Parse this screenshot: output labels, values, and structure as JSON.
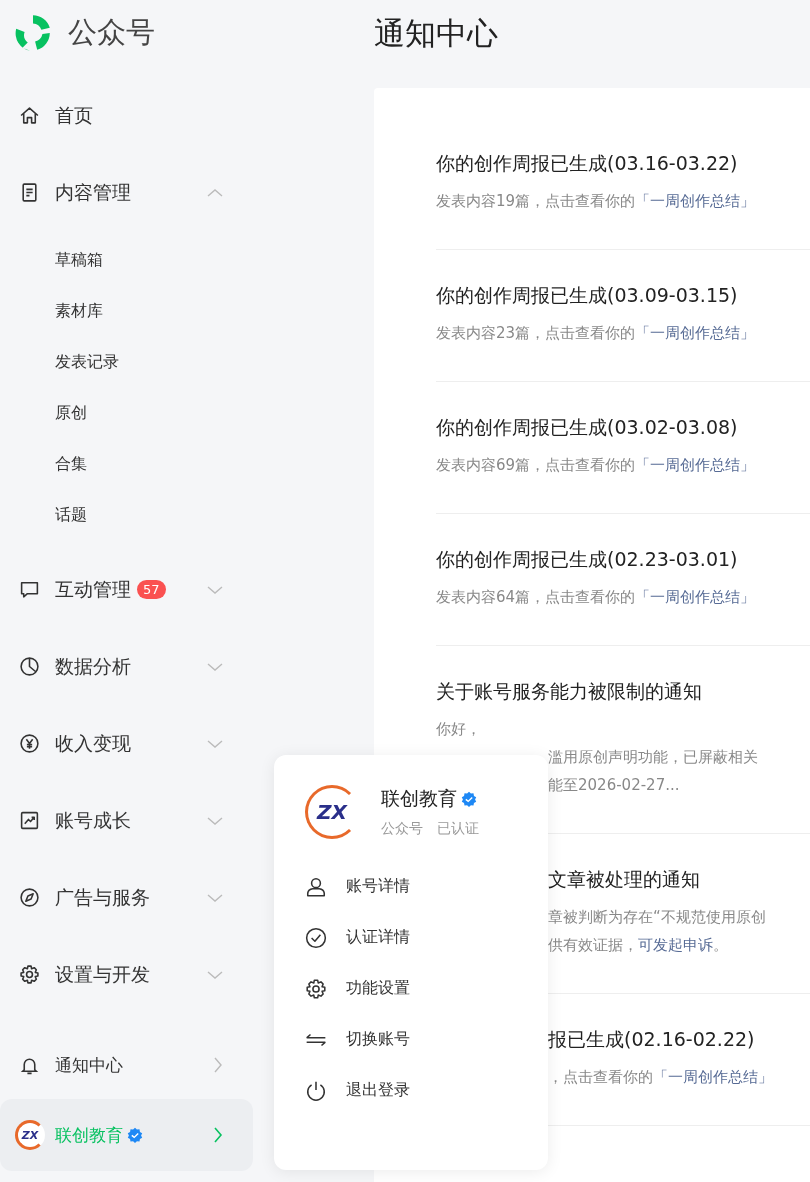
{
  "brand": {
    "name": "公众号"
  },
  "nav": [
    {
      "label": "首页",
      "kind": "home"
    },
    {
      "label": "内容管理",
      "kind": "document",
      "expanded": true,
      "children": [
        {
          "label": "草稿箱"
        },
        {
          "label": "素材库"
        },
        {
          "label": "发表记录"
        },
        {
          "label": "原创"
        },
        {
          "label": "合集"
        },
        {
          "label": "话题"
        }
      ]
    },
    {
      "label": "互动管理",
      "kind": "chat",
      "expanded": false,
      "badge": "57"
    },
    {
      "label": "数据分析",
      "kind": "pie",
      "expanded": false
    },
    {
      "label": "收入变现",
      "kind": "yen",
      "expanded": false
    },
    {
      "label": "账号成长",
      "kind": "trend",
      "expanded": false
    },
    {
      "label": "广告与服务",
      "kind": "compass",
      "expanded": false
    },
    {
      "label": "设置与开发",
      "kind": "gear",
      "expanded": false
    }
  ],
  "notification_link": {
    "label": "通知中心",
    "kind": "bell"
  },
  "account": {
    "logo_text": "ZX",
    "name": "联创教育",
    "verified": true,
    "selected": true
  },
  "page_title": "通知中心",
  "notices": [
    {
      "title": "你的创作周报已生成(03.16-03.22)",
      "title_clipped": false,
      "lines": [
        {
          "clipped": false,
          "parts": [
            {
              "kind": "text",
              "text": "发表内容19篇，点击查看你的"
            },
            {
              "kind": "link",
              "text": "「一周创作总结」"
            }
          ]
        }
      ]
    },
    {
      "title": "你的创作周报已生成(03.09-03.15)",
      "title_clipped": false,
      "lines": [
        {
          "clipped": false,
          "parts": [
            {
              "kind": "text",
              "text": "发表内容23篇，点击查看你的"
            },
            {
              "kind": "link",
              "text": "「一周创作总结」"
            }
          ]
        }
      ]
    },
    {
      "title": "你的创作周报已生成(03.02-03.08)",
      "title_clipped": false,
      "lines": [
        {
          "clipped": false,
          "parts": [
            {
              "kind": "text",
              "text": "发表内容69篇，点击查看你的"
            },
            {
              "kind": "link",
              "text": "「一周创作总结」"
            }
          ]
        }
      ]
    },
    {
      "title": "你的创作周报已生成(02.23-03.01)",
      "title_clipped": false,
      "lines": [
        {
          "clipped": false,
          "parts": [
            {
              "kind": "text",
              "text": "发表内容64篇，点击查看你的"
            },
            {
              "kind": "link",
              "text": "「一周创作总结」"
            }
          ]
        }
      ]
    },
    {
      "title": "关于账号服务能力被限制的通知",
      "title_clipped": false,
      "lines": [
        {
          "parts": [
            {
              "kind": "text",
              "text": "你好，"
            }
          ]
        },
        {
          "clipped": true,
          "parts": [
            {
              "kind": "text",
              "text": "滥用原创声明功能，已屏蔽相关"
            }
          ]
        },
        {
          "clipped": true,
          "parts": [
            {
              "kind": "text",
              "text": "能至2026-02-27..."
            }
          ]
        }
      ]
    },
    {
      "title": "文章被处理的通知",
      "title_clipped": true,
      "lines": [
        {
          "clipped": true,
          "parts": [
            {
              "kind": "text",
              "text": "章被判断为存在“不规范使用原创"
            }
          ]
        },
        {
          "clipped": true,
          "parts": [
            {
              "kind": "text",
              "text": "供有效证据，"
            },
            {
              "kind": "link",
              "text": "可发起申诉"
            },
            {
              "kind": "text",
              "text": "。"
            }
          ]
        }
      ]
    },
    {
      "title": "报已生成(02.16-02.22)",
      "title_clipped": true,
      "lines": [
        {
          "clipped": true,
          "parts": [
            {
              "kind": "text",
              "text": "，点击查看你的"
            },
            {
              "kind": "link",
              "text": "「一周创作总结」"
            }
          ]
        }
      ]
    }
  ],
  "popup": {
    "logo_text": "ZX",
    "name": "联创教育",
    "verified": true,
    "type": "公众号",
    "status": "已认证",
    "menu": [
      {
        "label": "账号详情",
        "kind": "user"
      },
      {
        "label": "认证详情",
        "kind": "check"
      },
      {
        "label": "功能设置",
        "kind": "gear"
      },
      {
        "label": "切换账号",
        "kind": "switch"
      },
      {
        "label": "退出登录",
        "kind": "power"
      }
    ]
  }
}
